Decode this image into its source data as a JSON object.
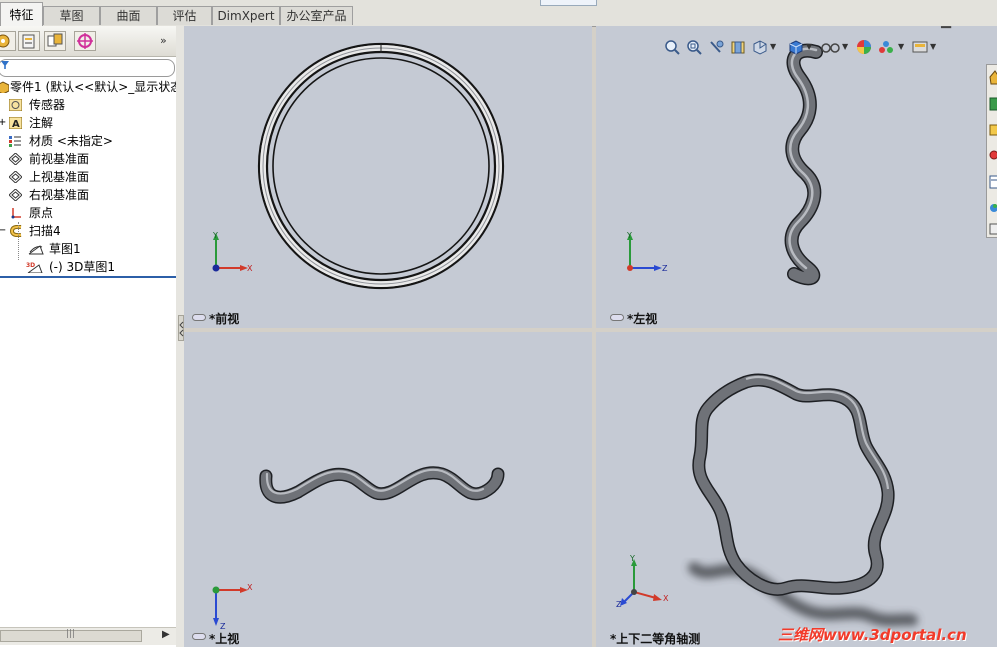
{
  "command_tabs": [
    "特征",
    "草图",
    "曲面",
    "评估",
    "DimXpert",
    "办公室产品"
  ],
  "active_tab": "特征",
  "panel": {
    "more_label": "»",
    "tree": [
      {
        "label": "零件1 (默认<<默认>_显示状态",
        "icon": "part-icon"
      },
      {
        "label": "传感器",
        "icon": "sensor-icon"
      },
      {
        "label": "注解",
        "icon": "annotations-icon"
      },
      {
        "label": "材质 <未指定>",
        "icon": "material-icon"
      },
      {
        "label": "前视基准面",
        "icon": "plane-icon"
      },
      {
        "label": "上视基准面",
        "icon": "plane-icon"
      },
      {
        "label": "右视基准面",
        "icon": "plane-icon"
      },
      {
        "label": "原点",
        "icon": "origin-icon"
      },
      {
        "label": "扫描4",
        "icon": "sweep-icon"
      },
      {
        "label": "草图1",
        "icon": "sketch-icon"
      },
      {
        "label": "(-) 3D草图1",
        "icon": "3d-sketch-icon"
      }
    ]
  },
  "views": {
    "front": {
      "label": "*前视"
    },
    "left": {
      "label": "*左视"
    },
    "top": {
      "label": "*上视"
    },
    "iso": {
      "label": "*上下二等角轴测"
    }
  },
  "axis_labels": {
    "x": "X",
    "y": "Y",
    "z": "Z"
  },
  "window_controls": {
    "minimize": "▁",
    "restore": "❐"
  },
  "watermark": "三维网www.3dportal.cn",
  "colors": {
    "viewport_bg": "#c5cad4",
    "tube": "#6f7278",
    "selection_blue": "#2c5fa8",
    "watermark": "#f23a2a"
  }
}
